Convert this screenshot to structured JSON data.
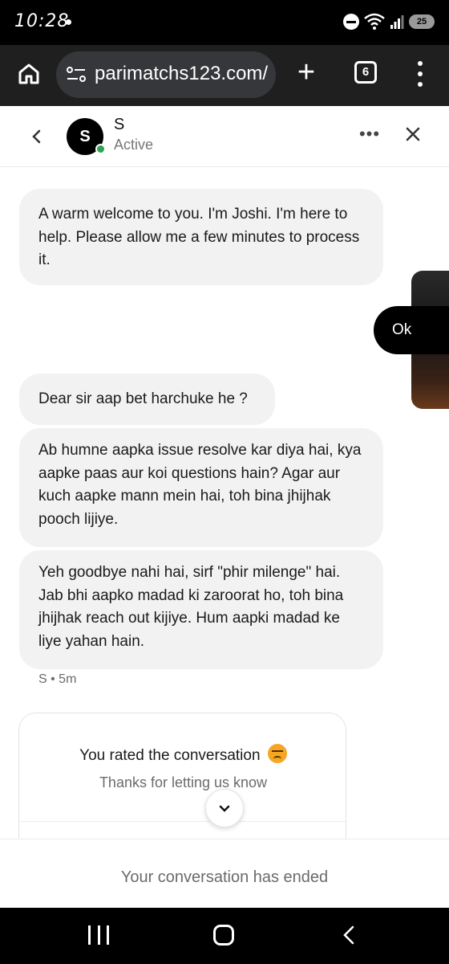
{
  "status_bar": {
    "time": "10:28",
    "battery": "25",
    "icons": [
      "dnd-icon",
      "wifi-icon",
      "signal-icon",
      "battery-icon"
    ]
  },
  "browser": {
    "url": "parimatchs123.com/",
    "tab_count": "6",
    "new_tab_label": "+"
  },
  "chat_header": {
    "avatar_letter": "S",
    "agent_name": "S",
    "status": "Active",
    "more_label": "•••",
    "online_color": "#2ea44f"
  },
  "messages": {
    "m1": "A warm welcome to you. I'm Joshi. I'm here to help. Please allow me a few minutes to process it.",
    "user_reply": "Ok",
    "m2": "Dear sir aap bet harchuke he ?",
    "m3": "Ab humne aapka issue resolve kar diya hai, kya aapke paas aur koi questions hain? Agar aur kuch aapke mann mein hai, toh bina jhijhak pooch lijiye.",
    "m4": "Yeh goodbye nahi hai, sirf \"phir milenge\" hai. Jab bhi aapko madad ki zaroorat ho, toh bina jhijhak reach out kijiye. Hum aapki madad ke liye yahan hain.",
    "meta": "S • 5m"
  },
  "rating": {
    "title": "You rated the conversation",
    "emoji": "angry-face-emoji",
    "subtitle": "Thanks for letting us know"
  },
  "footer": {
    "ended_text": "Your conversation has ended"
  },
  "colors": {
    "bubble_bg": "#f2f2f3",
    "user_bubble_bg": "#000000",
    "browser_bg": "#1f1f1f"
  }
}
